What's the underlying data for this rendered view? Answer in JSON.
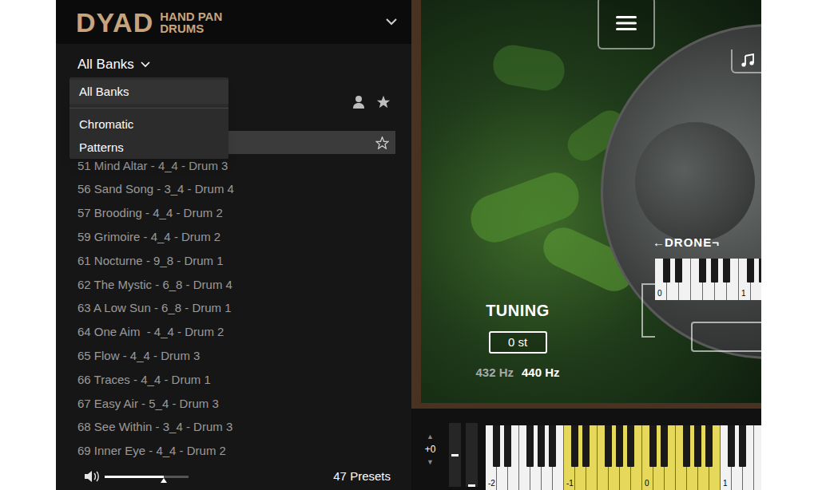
{
  "header": {
    "logo": "DYAD",
    "subtitle": [
      "HAND PAN",
      "DRUMS"
    ]
  },
  "bank_filter": {
    "label": "All Banks",
    "expanded": true
  },
  "bank_menu": [
    {
      "label": "All Banks",
      "selected": true
    },
    {
      "label": "Chromatic",
      "selected": false
    },
    {
      "label": "Patterns",
      "selected": false
    }
  ],
  "current_preset": {
    "selected": true
  },
  "presets": [
    {
      "name": "51 Mind Altar - 4_4 - Drum 3"
    },
    {
      "name": "56 Sand Song - 3_4 - Drum 4"
    },
    {
      "name": "57 Brooding - 4_4 - Drum 2"
    },
    {
      "name": "59 Grimoire - 4_4 - Drum 2"
    },
    {
      "name": "61 Nocturne - 9_8 - Drum 1"
    },
    {
      "name": "62 The Mystic - 6_8 - Drum 4"
    },
    {
      "name": "63 A Low Sun - 6_8 - Drum 1"
    },
    {
      "name": "64 One Aim  - 4_4 - Drum 2"
    },
    {
      "name": "65 Flow - 4_4 - Drum 3"
    },
    {
      "name": "66 Traces - 4_4 - Drum 1"
    },
    {
      "name": "67 Easy Air - 5_4 - Drum 3"
    },
    {
      "name": "68 See Within - 3_4 - Drum 3"
    },
    {
      "name": "69 Inner Eye - 4_4 - Drum 2"
    }
  ],
  "volume": {
    "level": 0.7
  },
  "preset_count": "47 Presets",
  "tuning": {
    "label": "TUNING",
    "value": "0 st",
    "options": [
      {
        "label": "432 Hz",
        "selected": false
      },
      {
        "label": "440 Hz",
        "selected": true
      }
    ]
  },
  "drone": {
    "arrow_left": "←",
    "label": "DRONE",
    "arrow_right": "¬",
    "octaves": [
      {
        "label": "0"
      },
      {
        "label": "1"
      }
    ]
  },
  "keyboard": {
    "up": "▲",
    "transpose": "+0",
    "down": "▼",
    "pitch_wheel": {
      "level": 0.5
    },
    "mod_wheel": {
      "level": 0
    },
    "octaves": [
      {
        "label": "-2",
        "highlighted": false
      },
      {
        "label": "-1",
        "highlighted": true
      },
      {
        "label": "0",
        "highlighted": true
      },
      {
        "label": "1",
        "highlighted": false
      }
    ]
  }
}
